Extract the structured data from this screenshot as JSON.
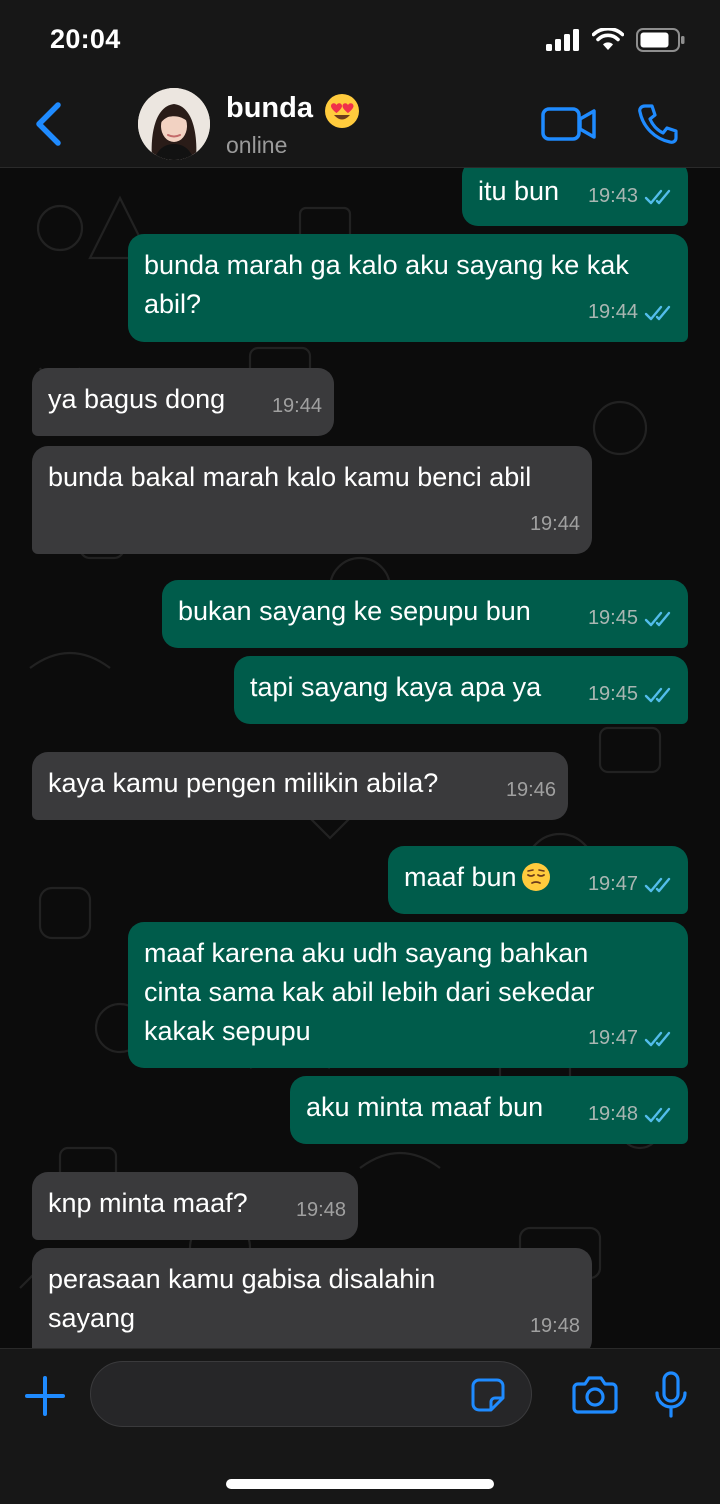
{
  "status_bar": {
    "time": "20:04"
  },
  "header": {
    "contact_name": "bunda",
    "contact_status": "online"
  },
  "messages": [
    {
      "text": "itu bun",
      "time": "19:43",
      "direction": "out",
      "read": true
    },
    {
      "text": "bunda marah ga kalo aku sayang ke kak abil?",
      "time": "19:44",
      "direction": "out",
      "read": true
    },
    {
      "text": "ya bagus dong",
      "time": "19:44",
      "direction": "in"
    },
    {
      "text": "bunda bakal marah kalo kamu benci abil",
      "time": "19:44",
      "direction": "in"
    },
    {
      "text": "bukan sayang ke sepupu bun",
      "time": "19:45",
      "direction": "out",
      "read": true
    },
    {
      "text": "tapi sayang kaya apa ya",
      "time": "19:45",
      "direction": "out",
      "read": true
    },
    {
      "text": "kaya kamu pengen milikin abila?",
      "time": "19:46",
      "direction": "in"
    },
    {
      "text": "maaf bun",
      "time": "19:47",
      "direction": "out",
      "read": true,
      "emoji": "pensive-face"
    },
    {
      "text": "maaf karena aku udh sayang bahkan cinta sama kak abil lebih dari sekedar kakak sepupu",
      "time": "19:47",
      "direction": "out",
      "read": true
    },
    {
      "text": "aku minta maaf bun",
      "time": "19:48",
      "direction": "out",
      "read": true
    },
    {
      "text": "knp minta maaf?",
      "time": "19:48",
      "direction": "in"
    },
    {
      "text": "perasaan kamu gabisa disalahin sayang",
      "time": "19:48",
      "direction": "in"
    }
  ],
  "colors": {
    "accent": "#1f8bff",
    "outgoing_bubble": "#005c4b",
    "incoming_bubble": "#3a3a3c",
    "read_ticks": "#53bdeb"
  },
  "icons": [
    "back-chevron-icon",
    "video-call-icon",
    "phone-icon",
    "plus-icon",
    "sticker-icon",
    "camera-icon",
    "microphone-icon"
  ]
}
